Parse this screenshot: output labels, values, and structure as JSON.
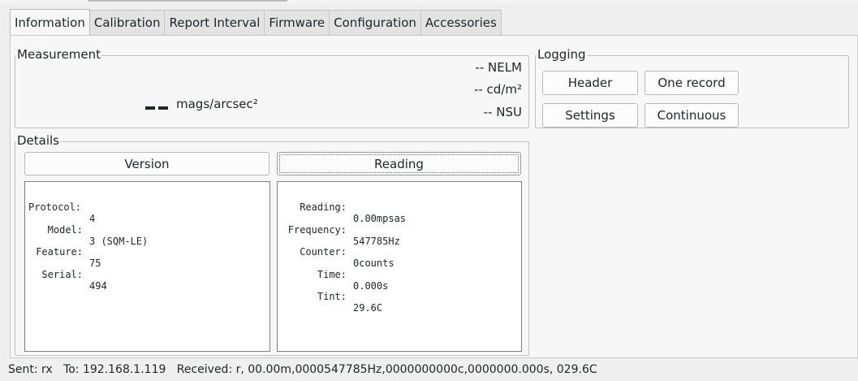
{
  "tabs": [
    {
      "label": "Information"
    },
    {
      "label": "Calibration"
    },
    {
      "label": "Report Interval"
    },
    {
      "label": "Firmware"
    },
    {
      "label": "Configuration"
    },
    {
      "label": "Accessories"
    }
  ],
  "measurement": {
    "title": "Measurement",
    "value_placeholder": "--",
    "unit": "mags/arcsec²",
    "nelm": "-- NELM",
    "cdm2": "-- cd/m²",
    "nsu": "-- NSU"
  },
  "logging": {
    "title": "Logging",
    "header_button": "Header",
    "one_record_button": "One record",
    "settings_button": "Settings",
    "continuous_button": "Continuous"
  },
  "details": {
    "title": "Details",
    "version_button": "Version",
    "reading_button": "Reading",
    "version_rows": [
      {
        "key": "Protocol:",
        "value": "4"
      },
      {
        "key": "Model:",
        "value": "3 (SQM-LE)"
      },
      {
        "key": "Feature:",
        "value": "75"
      },
      {
        "key": "Serial:",
        "value": "494"
      }
    ],
    "reading_rows": [
      {
        "key": "Reading:",
        "value": "0.00mpsas"
      },
      {
        "key": "Frequency:",
        "value": "547785Hz"
      },
      {
        "key": "Counter:",
        "value": "0counts"
      },
      {
        "key": "Time:",
        "value": "0.000s"
      },
      {
        "key": "Tint:",
        "value": "29.6C"
      }
    ]
  },
  "status_bar": {
    "sent": "Sent: rx",
    "to": "To: 192.168.1.119",
    "received": "Received: r, 00.00m,0000547785Hz,0000000000c,0000000.000s, 029.6C"
  }
}
